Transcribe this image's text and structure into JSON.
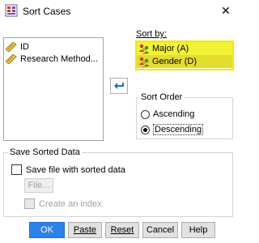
{
  "window": {
    "title": "Sort Cases",
    "close_glyph": "✕"
  },
  "variables": {
    "items": [
      {
        "label": "ID",
        "icon": "ruler-icon"
      },
      {
        "label": "Research Method...",
        "icon": "ruler-icon"
      }
    ]
  },
  "move_button": {
    "icon": "arrow-left-icon"
  },
  "sort_by": {
    "label": "Sort by:",
    "items": [
      {
        "label": "Major (A)",
        "icon": "nominal-person-icon"
      },
      {
        "label": "Gender (D)",
        "icon": "nominal-person-icon"
      }
    ],
    "highlight_color": "#f2e70c"
  },
  "sort_order": {
    "label": "Sort Order",
    "ascending": "Ascending",
    "descending": "Descending",
    "selected": "Descending"
  },
  "save_sorted": {
    "label": "Save Sorted Data",
    "checkbox_label": "Save file with sorted data",
    "checked": false,
    "file_button": "File...",
    "index_label": "Create an index"
  },
  "buttons": {
    "ok": "OK",
    "paste": "Paste",
    "reset": "Reset",
    "cancel": "Cancel",
    "help": "Help"
  },
  "colors": {
    "primary": "#2b83e8",
    "move_arrow": "#1e6fc8"
  }
}
